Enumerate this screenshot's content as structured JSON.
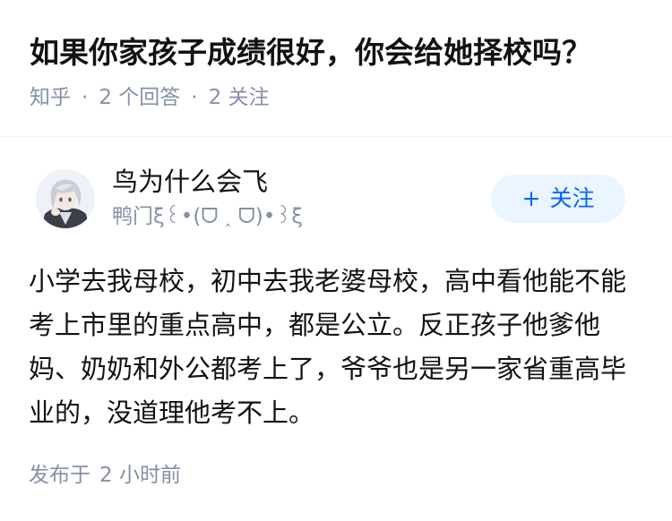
{
  "question": {
    "title": "如果你家孩子成绩很好，你会给她择校吗？",
    "source": "知乎",
    "separator": "·",
    "answers_count": "2 个回答",
    "followers_count": "2 关注"
  },
  "author": {
    "name": "鸟为什么会飞",
    "bio": "鸭门ξ꒰•(ᗜ ˰ ᗜ)•꒱ξ",
    "avatar_icon": "avatar-anime-character"
  },
  "follow_button": {
    "icon": "+",
    "label": "关注",
    "text_color": "#0066ff",
    "bg_color": "#ebf5ff"
  },
  "answer": {
    "content": "小学去我母校，初中去我老婆母校，高中看他能不能考上市里的重点高中，都是公立。反正孩子他爹他妈、奶奶和外公都考上了，爷爷也是另一家省重高毕业的，没道理他考不上。",
    "published_label": "发布于",
    "published_time": "2 小时前"
  }
}
